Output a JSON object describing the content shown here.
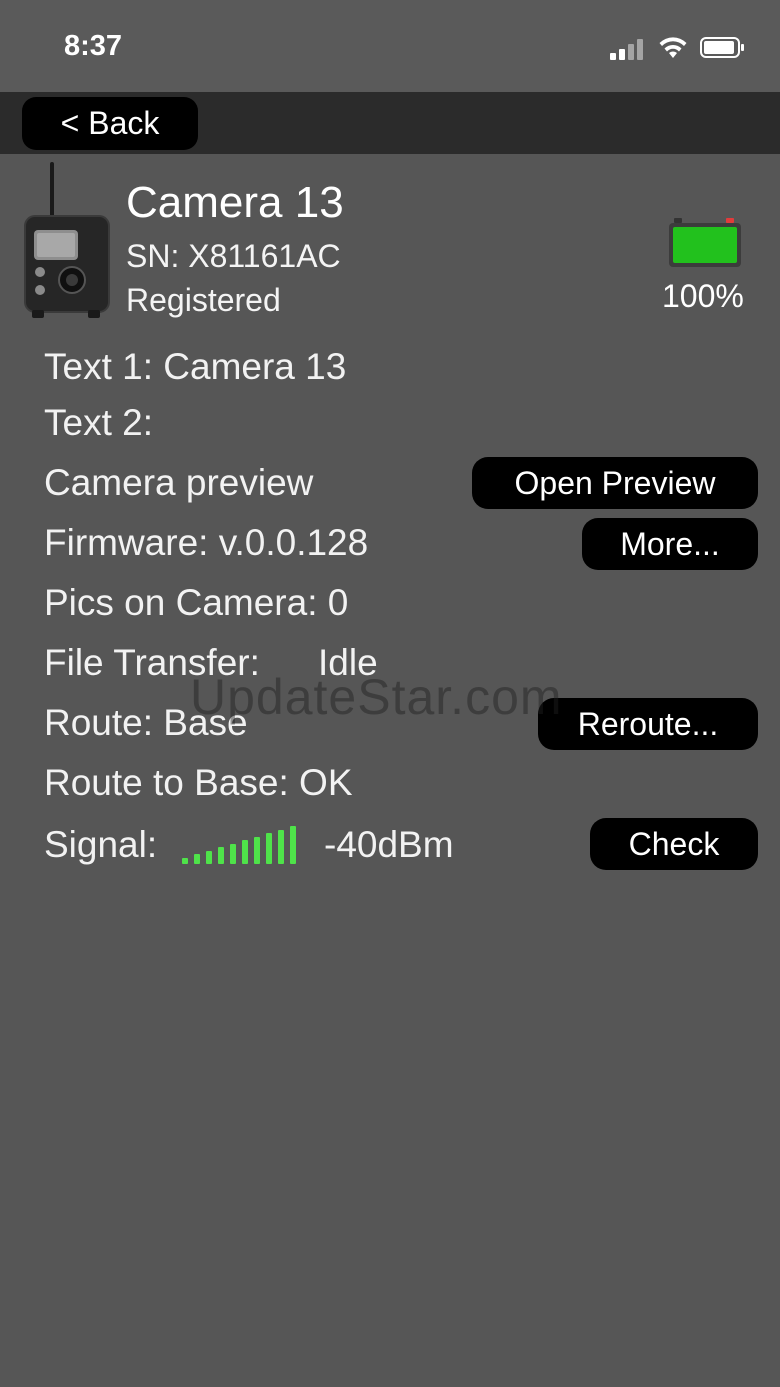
{
  "status_bar": {
    "time": "8:37",
    "icons": [
      "cellular-signal-icon",
      "wifi-icon",
      "battery-icon"
    ]
  },
  "nav": {
    "back_label": "< Back"
  },
  "camera": {
    "name": "Camera 13",
    "serial": "SN: X81161AC",
    "status": "Registered",
    "battery_percent": "100%",
    "battery_level": 1.0,
    "battery_color": "#22c11d"
  },
  "details": {
    "text1": "Text 1: Camera 13",
    "text2": "Text 2:",
    "preview_label": "Camera preview",
    "preview_button": "Open Preview",
    "firmware": "Firmware: v.0.0.128",
    "firmware_button": "More...",
    "pics": "Pics on Camera: 0",
    "file_transfer_label": "File Transfer:",
    "file_transfer_value": "Idle",
    "route": "Route: Base",
    "route_button": "Reroute...",
    "route_to_base": "Route to Base: OK",
    "signal_label": "Signal:",
    "signal_value": "-40dBm",
    "signal_bars_lit": 10,
    "signal_bars_total": 10,
    "signal_color": "#4fe34a",
    "check_button": "Check"
  },
  "watermark": "UpdateStar.com"
}
